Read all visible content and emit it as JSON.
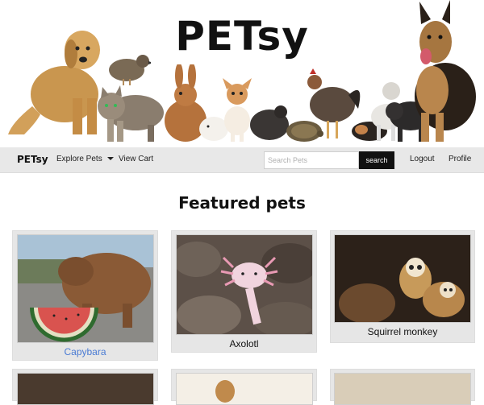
{
  "hero": {
    "title": "PETsy"
  },
  "navbar": {
    "brand": "PETsy",
    "explore_label": "Explore Pets",
    "cart_label": "View Cart",
    "search": {
      "placeholder": "Search Pets",
      "value": ""
    },
    "search_button_label": "search",
    "logout_label": "Logout",
    "profile_label": "Profile"
  },
  "featured": {
    "title": "Featured pets",
    "cards": [
      {
        "name": "Capybara"
      },
      {
        "name": "Axolotl"
      },
      {
        "name": "Squirrel monkey"
      }
    ]
  },
  "colors": {
    "navbar_bg": "#e8e8e8",
    "card_bg": "#e6e6e6",
    "link": "#4a7bd4",
    "button_bg": "#111111"
  }
}
